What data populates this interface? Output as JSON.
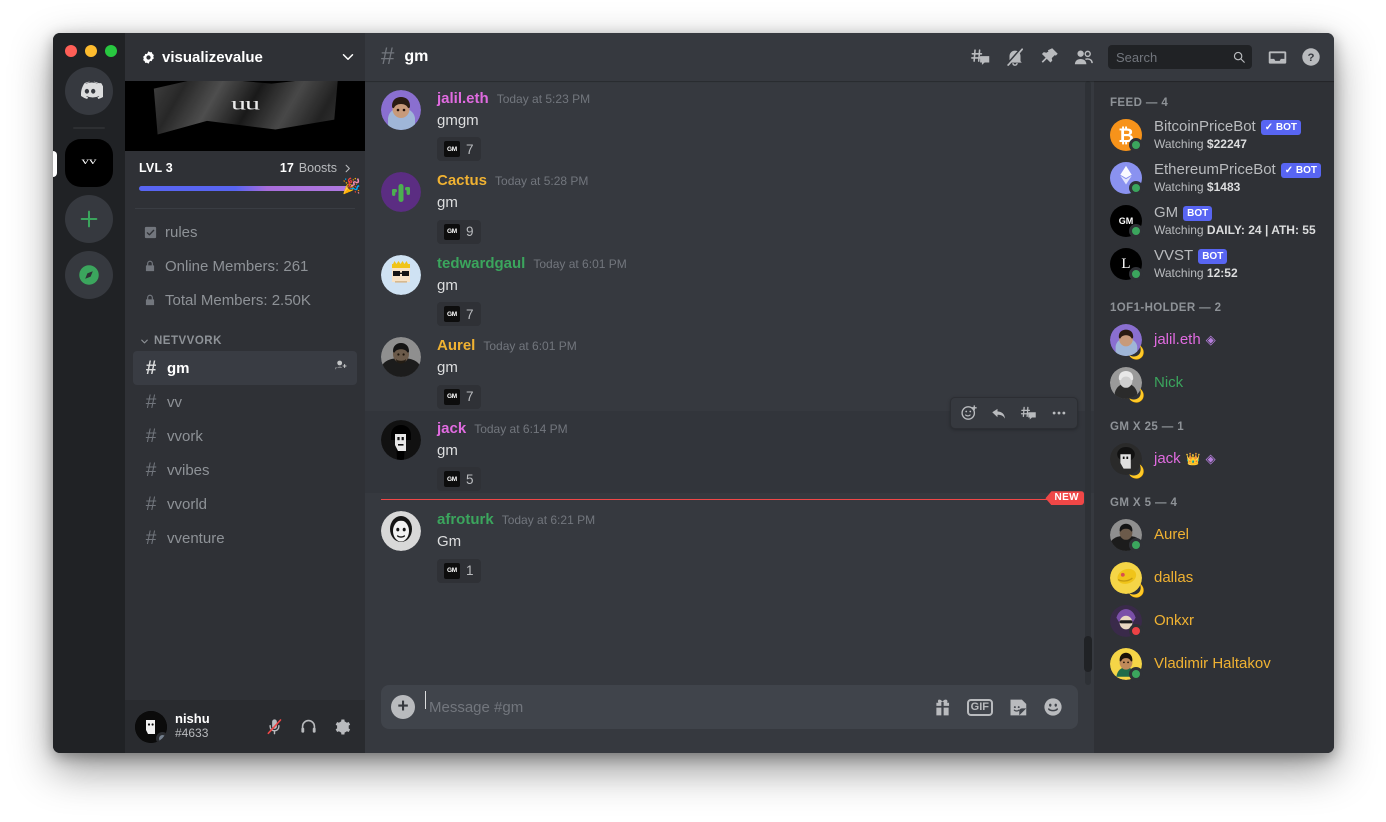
{
  "window": {
    "traffic_lights": [
      "#ff5f57",
      "#febc2e",
      "#28c840"
    ]
  },
  "rail": {
    "items": [
      {
        "name": "discord-home",
        "label": "Discord"
      },
      {
        "name": "server-visualizevalue",
        "label": "vv",
        "active": true
      },
      {
        "name": "add-server",
        "label": "+"
      },
      {
        "name": "explore-servers",
        "label": "compass"
      }
    ]
  },
  "sidebar": {
    "guild_name": "visualizevalue",
    "banner_mark": "uu",
    "boost": {
      "level_label": "LVL 3",
      "count": "17",
      "count_label": "Boosts",
      "emoji": "🎉"
    },
    "special_channels": [
      {
        "icon": "checkbox-icon",
        "label": "rules"
      },
      {
        "icon": "lock-icon",
        "label": "Online Members: 261"
      },
      {
        "icon": "lock-icon",
        "label": "Total Members: 2.50K"
      }
    ],
    "category": "NETVVORK",
    "channels": [
      {
        "label": "gm",
        "active": true
      },
      {
        "label": "vv",
        "active": false
      },
      {
        "label": "vvork",
        "active": false
      },
      {
        "label": "vvibes",
        "active": false
      },
      {
        "label": "vvorld",
        "active": false
      },
      {
        "label": "vventure",
        "active": false
      }
    ],
    "user": {
      "name": "nishu",
      "tag": "#4633",
      "buttons": [
        "mute-microphone",
        "deafen-headphones",
        "user-settings"
      ]
    }
  },
  "header": {
    "channel": "gm",
    "icons": [
      "create-thread-icon",
      "notification-off-icon",
      "pinned-messages-icon",
      "member-list-icon",
      "inbox-icon",
      "help-icon"
    ]
  },
  "search": {
    "placeholder": "Search",
    "value": ""
  },
  "messages": [
    {
      "author": "jalil.eth",
      "author_color": "#e06be0",
      "timestamp": "Today at 5:23 PM",
      "text": "gmgm",
      "reaction": {
        "emoji": "GM",
        "count": "7"
      },
      "avatar": {
        "bg": "#8a6fd0",
        "face": "#c79a7a",
        "hair": "#221a14"
      }
    },
    {
      "author": "Cactus",
      "author_color": "#f0b232",
      "timestamp": "Today at 5:28 PM",
      "text": "gm",
      "reaction": {
        "emoji": "GM",
        "count": "9"
      },
      "avatar": {
        "bg": "#5b2d82",
        "face": "#4caf50",
        "hair": "#2e7d32"
      }
    },
    {
      "author": "tedwardgaul",
      "author_color": "#3ba55d",
      "timestamp": "Today at 6:01 PM",
      "text": "gm",
      "reaction": {
        "emoji": "GM",
        "count": "7"
      },
      "avatar": {
        "bg": "#cfe2f3",
        "face": "#f7e2c5",
        "hair": "#f0c419"
      }
    },
    {
      "author": "Aurel",
      "author_color": "#f0b232",
      "timestamp": "Today at 6:01 PM",
      "text": "gm",
      "reaction": {
        "emoji": "GM",
        "count": "7"
      },
      "avatar": {
        "bg": "#8f8f8f",
        "face": "#6b5a4a",
        "hair": "#1a1a1a"
      }
    },
    {
      "author": "jack",
      "author_color": "#e06be0",
      "timestamp": "Today at 6:14 PM",
      "text": "gm",
      "reaction": {
        "emoji": "GM",
        "count": "5"
      },
      "hovered": true,
      "avatar": {
        "bg": "#111111",
        "face": "#e8e8e8",
        "hair": "#000000"
      }
    },
    {
      "author": "afroturk",
      "author_color": "#3ba55d",
      "timestamp": "Today at 6:21 PM",
      "text": "Gm",
      "reaction": {
        "emoji": "GM",
        "count": "1"
      },
      "avatar": {
        "bg": "#d8d8d8",
        "face": "#f2f2f2",
        "hair": "#151515"
      }
    }
  ],
  "new_divider": {
    "label": "NEW",
    "color": "#f04747"
  },
  "hover_toolbar": [
    "add-reaction-icon",
    "reply-icon",
    "create-thread-icon",
    "more-options-icon"
  ],
  "composer": {
    "placeholder": "Message #gm",
    "value": "",
    "icons": [
      "gift-icon",
      "gif-icon",
      "sticker-icon",
      "emoji-icon"
    ],
    "gif_label": "GIF"
  },
  "members": {
    "groups": [
      {
        "label": "FEED — 4",
        "rows": [
          {
            "name": "BitcoinPriceBot",
            "name_color": "#b9bbbe",
            "badge": "✓ BOT",
            "sub_prefix": "Watching ",
            "sub_strong": "$22247",
            "status": "online",
            "avatar": {
              "bg": "#f7931a",
              "glyph": "₿",
              "glyph_color": "#ffffff"
            }
          },
          {
            "name": "EthereumPriceBot",
            "name_color": "#b9bbbe",
            "badge": "✓ BOT",
            "sub_prefix": "Watching ",
            "sub_strong": "$1483",
            "status": "online",
            "avatar": {
              "bg": "#8a92f0",
              "glyph": "◆",
              "glyph_color": "#ffffff"
            }
          },
          {
            "name": "GM",
            "name_color": "#b9bbbe",
            "badge": "BOT",
            "sub_prefix": "Watching ",
            "sub_strong": "DAILY: 24 | ATH: 55",
            "status": "online",
            "avatar": {
              "bg": "#000000",
              "glyph": "GM",
              "glyph_color": "#ffffff"
            }
          },
          {
            "name": "VVST",
            "name_color": "#b9bbbe",
            "badge": "BOT",
            "sub_prefix": "Watching ",
            "sub_strong": "12:52",
            "status": "online",
            "avatar": {
              "bg": "#000000",
              "glyph": "L",
              "glyph_color": "#ffffff"
            }
          }
        ]
      },
      {
        "label": "1OF1-HOLDER — 2",
        "rows": [
          {
            "name": "jalil.eth",
            "name_color": "#e06be0",
            "gem": true,
            "status": "idle-moon",
            "avatar": {
              "bg": "#8a6fd0",
              "glyph": "",
              "glyph_color": "#ffffff"
            }
          },
          {
            "name": "Nick",
            "name_color": "#3ba55d",
            "status": "idle-moon",
            "avatar": {
              "bg": "#9a9a9a",
              "glyph": "",
              "glyph_color": "#ffffff"
            }
          }
        ]
      },
      {
        "label": "GM X 25 — 1",
        "rows": [
          {
            "name": "jack",
            "name_color": "#e06be0",
            "crown": true,
            "gem": true,
            "status": "idle-moon",
            "avatar": {
              "bg": "#2a2a2a",
              "glyph": "",
              "glyph_color": "#ffffff"
            }
          }
        ]
      },
      {
        "label": "GM X 5 — 4",
        "rows": [
          {
            "name": "Aurel",
            "name_color": "#f0b232",
            "status": "online",
            "avatar": {
              "bg": "#8f8f8f",
              "glyph": "",
              "glyph_color": "#ffffff"
            }
          },
          {
            "name": "dallas",
            "name_color": "#f0b232",
            "status": "idle-moon",
            "avatar": {
              "bg": "#f5d547",
              "glyph": "",
              "glyph_color": "#ffffff"
            }
          },
          {
            "name": "Onkxr",
            "name_color": "#f0b232",
            "status": "dnd",
            "avatar": {
              "bg": "#3a2a4a",
              "glyph": "",
              "glyph_color": "#ffffff"
            }
          },
          {
            "name": "Vladimir Haltakov",
            "name_color": "#f0b232",
            "status": "online",
            "avatar": {
              "bg": "#f5d547",
              "glyph": "",
              "glyph_color": "#ffffff"
            }
          }
        ]
      }
    ]
  },
  "colors": {
    "accent": "#5865f2",
    "online": "#3ba55d",
    "dnd": "#ed4245",
    "idle": "#faa81a",
    "new": "#f04747",
    "bg_main": "#36393f",
    "bg_sidebar": "#2f3136",
    "bg_rail": "#202225"
  }
}
